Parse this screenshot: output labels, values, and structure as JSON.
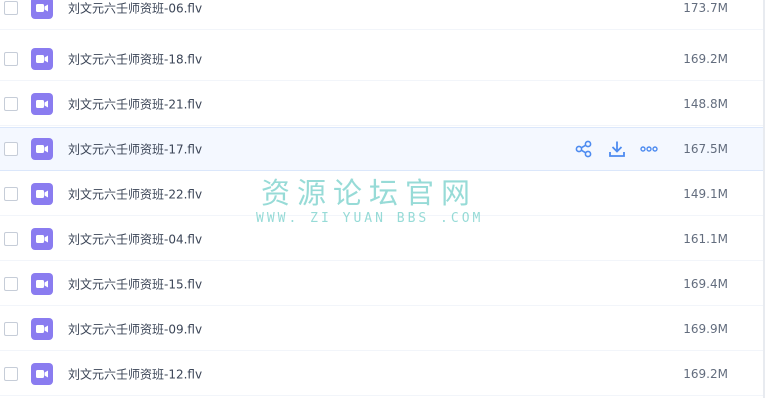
{
  "files": [
    {
      "name": "刘文元六壬师资班-06.flv",
      "size": "173.7M",
      "icon": "video-file-icon"
    },
    {
      "name": "刘文元六壬师资班-18.flv",
      "size": "169.2M",
      "icon": "video-file-icon"
    },
    {
      "name": "刘文元六壬师资班-21.flv",
      "size": "148.8M",
      "icon": "video-file-icon"
    },
    {
      "name": "刘文元六壬师资班-17.flv",
      "size": "167.5M",
      "icon": "video-file-icon",
      "hovered": true
    },
    {
      "name": "刘文元六壬师资班-22.flv",
      "size": "149.1M",
      "icon": "video-file-icon"
    },
    {
      "name": "刘文元六壬师资班-04.flv",
      "size": "161.1M",
      "icon": "video-file-icon"
    },
    {
      "name": "刘文元六壬师资班-15.flv",
      "size": "169.4M",
      "icon": "video-file-icon"
    },
    {
      "name": "刘文元六壬师资班-09.flv",
      "size": "169.9M",
      "icon": "video-file-icon"
    },
    {
      "name": "刘文元六壬师资班-12.flv",
      "size": "169.2M",
      "icon": "video-file-icon"
    }
  ],
  "row_actions": [
    "share-icon",
    "download-icon",
    "more-icon"
  ],
  "watermark": {
    "title": "资源论坛官网",
    "subtitle": "WWW. ZI YUAN BBS .COM"
  },
  "colors": {
    "accent": "#4d8bf0",
    "file_icon": "#8a7cf0",
    "watermark": "#42beb6",
    "hover_row": "#f4f8ff"
  }
}
